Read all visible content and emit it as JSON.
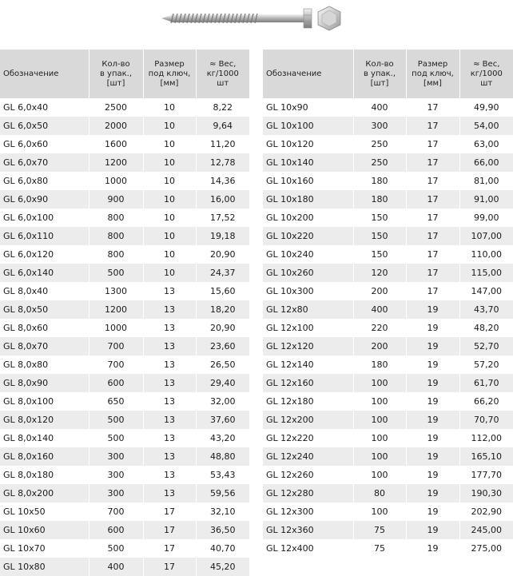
{
  "headers": {
    "designation": "Обозначение",
    "qty": [
      "Кол-во",
      "в упак.,",
      "[шт]"
    ],
    "key": [
      "Размер",
      "под ключ,",
      "[мм]"
    ],
    "weight": [
      "≈ Вес,",
      "кг/1000",
      "шт"
    ]
  },
  "left_rows": [
    [
      "GL 6,0x40",
      "2500",
      "10",
      "8,22"
    ],
    [
      "GL 6,0x50",
      "2000",
      "10",
      "9,64"
    ],
    [
      "GL 6,0x60",
      "1600",
      "10",
      "11,20"
    ],
    [
      "GL 6,0x70",
      "1200",
      "10",
      "12,78"
    ],
    [
      "GL 6,0x80",
      "1000",
      "10",
      "14,36"
    ],
    [
      "GL 6,0x90",
      "900",
      "10",
      "16,00"
    ],
    [
      "GL 6,0x100",
      "800",
      "10",
      "17,52"
    ],
    [
      "GL 6,0x110",
      "800",
      "10",
      "19,18"
    ],
    [
      "GL 6,0x120",
      "800",
      "10",
      "20,90"
    ],
    [
      "GL 6,0x140",
      "500",
      "10",
      "24,37"
    ],
    [
      "GL 8,0x40",
      "1300",
      "13",
      "15,60"
    ],
    [
      "GL 8,0x50",
      "1200",
      "13",
      "18,20"
    ],
    [
      "GL 8,0x60",
      "1000",
      "13",
      "20,90"
    ],
    [
      "GL 8,0x70",
      "700",
      "13",
      "23,60"
    ],
    [
      "GL 8,0x80",
      "700",
      "13",
      "26,50"
    ],
    [
      "GL 8,0x90",
      "600",
      "13",
      "29,40"
    ],
    [
      "GL 8,0x100",
      "650",
      "13",
      "32,00"
    ],
    [
      "GL 8,0x120",
      "500",
      "13",
      "37,60"
    ],
    [
      "GL 8,0x140",
      "500",
      "13",
      "43,20"
    ],
    [
      "GL 8,0x160",
      "300",
      "13",
      "48,80"
    ],
    [
      "GL 8,0x180",
      "300",
      "13",
      "53,43"
    ],
    [
      "GL 8,0x200",
      "300",
      "13",
      "59,56"
    ],
    [
      "GL 10x50",
      "700",
      "17",
      "32,10"
    ],
    [
      "GL 10x60",
      "600",
      "17",
      "36,50"
    ],
    [
      "GL 10x70",
      "500",
      "17",
      "40,70"
    ],
    [
      "GL 10x80",
      "400",
      "17",
      "45,20"
    ]
  ],
  "right_rows": [
    [
      "GL 10x90",
      "400",
      "17",
      "49,90"
    ],
    [
      "GL 10x100",
      "300",
      "17",
      "54,00"
    ],
    [
      "GL 10x120",
      "250",
      "17",
      "63,00"
    ],
    [
      "GL 10x140",
      "250",
      "17",
      "66,00"
    ],
    [
      "GL 10x160",
      "180",
      "17",
      "81,00"
    ],
    [
      "GL 10x180",
      "180",
      "17",
      "91,00"
    ],
    [
      "GL 10x200",
      "150",
      "17",
      "99,00"
    ],
    [
      "GL 10x220",
      "150",
      "17",
      "107,00"
    ],
    [
      "GL 10x240",
      "150",
      "17",
      "110,00"
    ],
    [
      "GL 10x260",
      "120",
      "17",
      "115,00"
    ],
    [
      "GL 10x300",
      "200",
      "17",
      "147,00"
    ],
    [
      "GL 12x80",
      "400",
      "19",
      "43,70"
    ],
    [
      "GL 12x100",
      "220",
      "19",
      "48,20"
    ],
    [
      "GL 12x120",
      "200",
      "19",
      "52,70"
    ],
    [
      "GL 12x140",
      "180",
      "19",
      "57,20"
    ],
    [
      "GL 12x160",
      "100",
      "19",
      "61,70"
    ],
    [
      "GL 12x180",
      "100",
      "19",
      "66,20"
    ],
    [
      "GL 12x200",
      "100",
      "19",
      "70,70"
    ],
    [
      "GL 12x220",
      "100",
      "19",
      "112,00"
    ],
    [
      "GL 12x240",
      "100",
      "19",
      "165,10"
    ],
    [
      "GL 12x260",
      "100",
      "19",
      "177,70"
    ],
    [
      "GL 12x280",
      "80",
      "19",
      "190,30"
    ],
    [
      "GL 12x300",
      "100",
      "19",
      "202,90"
    ],
    [
      "GL 12x360",
      "75",
      "19",
      "245,00"
    ],
    [
      "GL 12x400",
      "75",
      "19",
      "275,00"
    ]
  ]
}
